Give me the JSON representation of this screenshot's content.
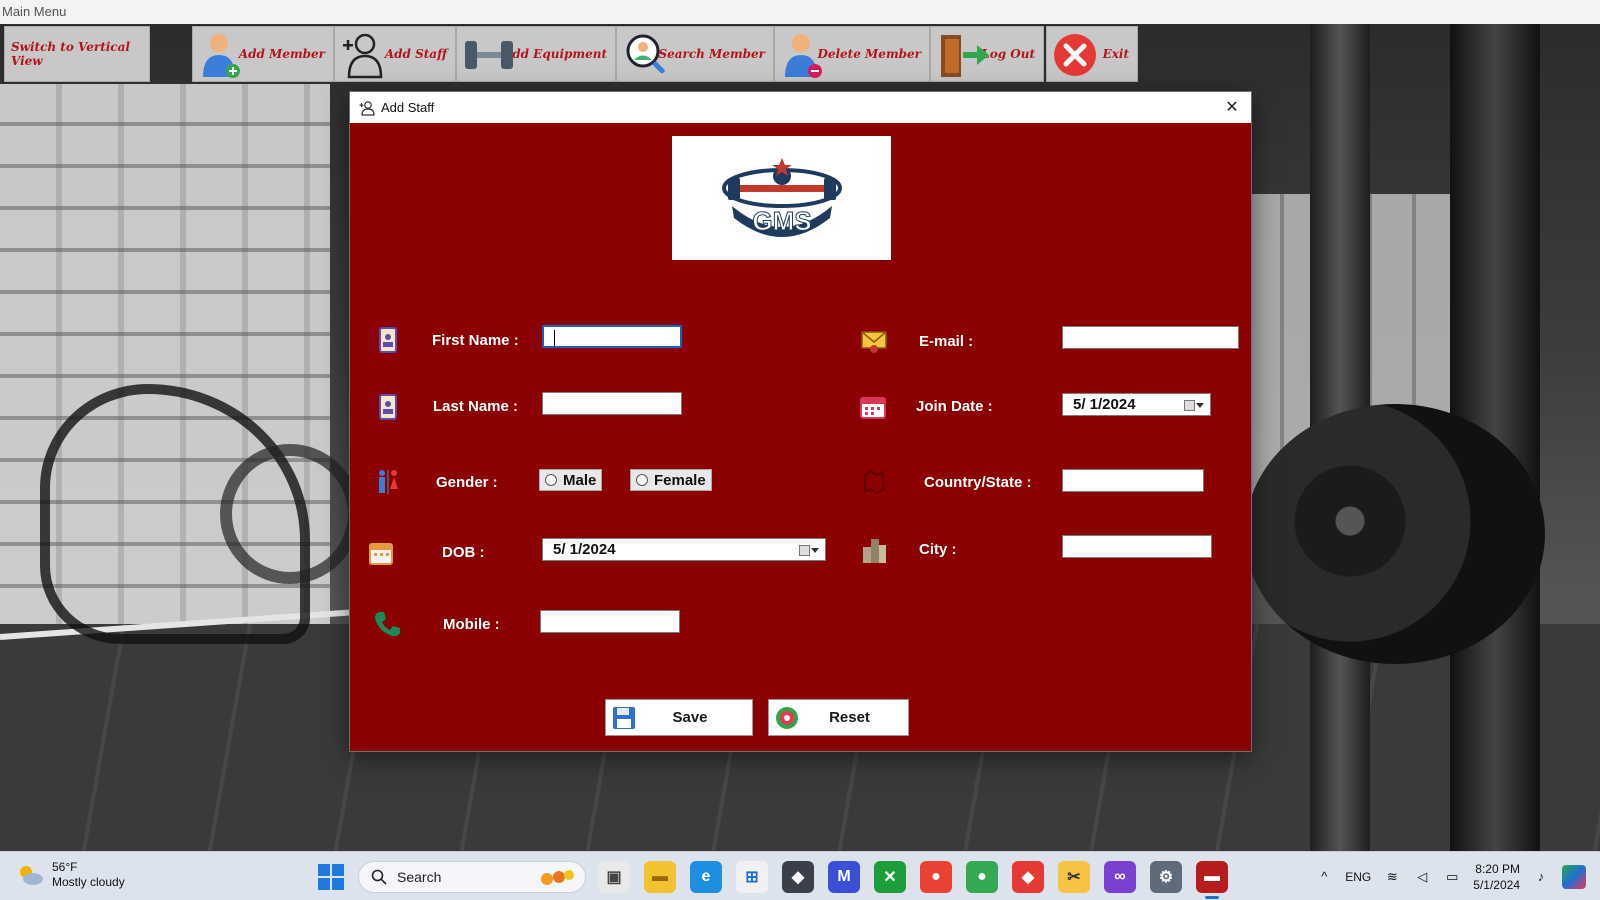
{
  "app": {
    "title": "Main Menu"
  },
  "toolbar": {
    "switch_view": "Switch to Vertical View",
    "add_member": "Add Member",
    "add_staff": "Add Staff",
    "add_equipment": "Add Equipment",
    "search_member": "Search Member",
    "delete_member": "Delete Member",
    "log_out": "Log Out",
    "exit": "Exit"
  },
  "dialog": {
    "title": "Add Staff",
    "logo_text": "GMS",
    "labels": {
      "first_name": "First Name :",
      "last_name": "Last Name :",
      "gender": "Gender :",
      "dob": "DOB :",
      "mobile": "Mobile :",
      "email": "E-mail :",
      "join_date": "Join Date :",
      "country_state": "Country/State :",
      "city": "City :"
    },
    "values": {
      "first_name": "",
      "last_name": "",
      "mobile": "",
      "email": "",
      "country_state": "",
      "city": "",
      "dob": "5/  1/2024",
      "join_date": "5/  1/2024"
    },
    "gender_options": {
      "male": "Male",
      "female": "Female"
    },
    "buttons": {
      "save": "Save",
      "reset": "Reset"
    },
    "colors": {
      "background": "#8b0000",
      "label": "#ffffff"
    }
  },
  "taskbar": {
    "weather_temp": "56°F",
    "weather_desc": "Mostly cloudy",
    "search_placeholder": "Search",
    "language": "ENG",
    "time": "8:20 PM",
    "date": "5/1/2024"
  }
}
